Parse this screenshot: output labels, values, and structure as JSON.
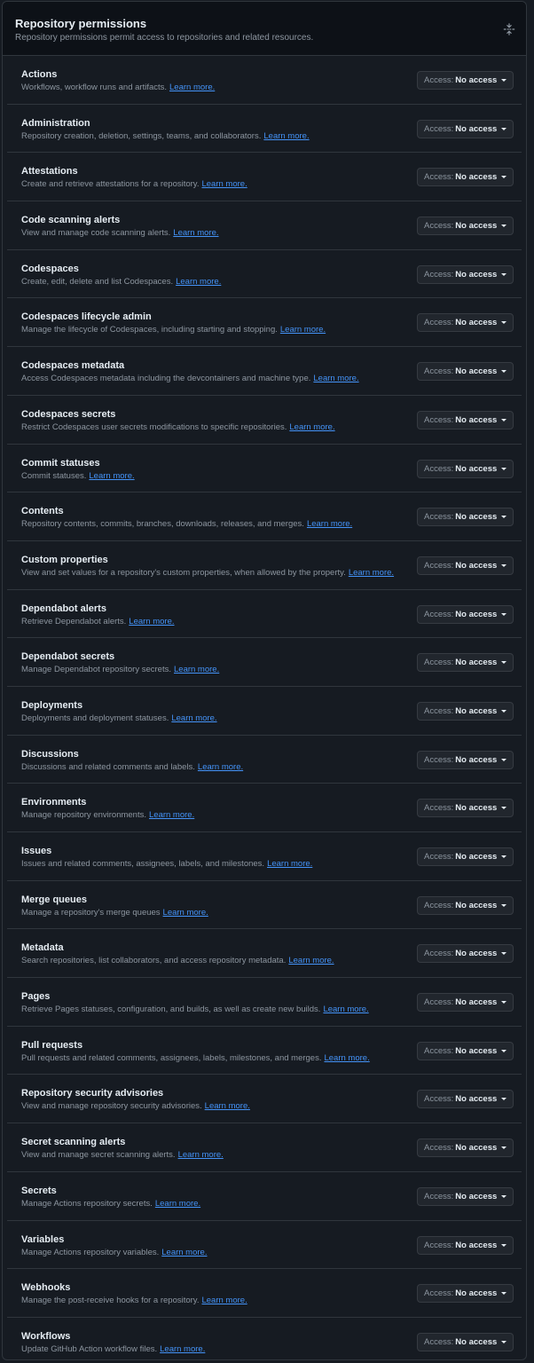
{
  "header": {
    "title": "Repository permissions",
    "subtitle": "Repository permissions permit access to repositories and related resources.",
    "fold_icon": "fold-icon"
  },
  "access_label": "Access:",
  "learn_more_label": "Learn more.",
  "permissions": [
    {
      "name": "Actions",
      "description": "Workflows, workflow runs and artifacts.",
      "access": "No access"
    },
    {
      "name": "Administration",
      "description": "Repository creation, deletion, settings, teams, and collaborators.",
      "access": "No access"
    },
    {
      "name": "Attestations",
      "description": "Create and retrieve attestations for a repository.",
      "access": "No access"
    },
    {
      "name": "Code scanning alerts",
      "description": "View and manage code scanning alerts.",
      "access": "No access"
    },
    {
      "name": "Codespaces",
      "description": "Create, edit, delete and list Codespaces.",
      "access": "No access"
    },
    {
      "name": "Codespaces lifecycle admin",
      "description": "Manage the lifecycle of Codespaces, including starting and stopping.",
      "access": "No access"
    },
    {
      "name": "Codespaces metadata",
      "description": "Access Codespaces metadata including the devcontainers and machine type.",
      "access": "No access"
    },
    {
      "name": "Codespaces secrets",
      "description": "Restrict Codespaces user secrets modifications to specific repositories.",
      "access": "No access"
    },
    {
      "name": "Commit statuses",
      "description": "Commit statuses.",
      "access": "No access"
    },
    {
      "name": "Contents",
      "description": "Repository contents, commits, branches, downloads, releases, and merges.",
      "access": "No access"
    },
    {
      "name": "Custom properties",
      "description": "View and set values for a repository's custom properties, when allowed by the property.",
      "access": "No access"
    },
    {
      "name": "Dependabot alerts",
      "description": "Retrieve Dependabot alerts.",
      "access": "No access"
    },
    {
      "name": "Dependabot secrets",
      "description": "Manage Dependabot repository secrets.",
      "access": "No access"
    },
    {
      "name": "Deployments",
      "description": "Deployments and deployment statuses.",
      "access": "No access"
    },
    {
      "name": "Discussions",
      "description": "Discussions and related comments and labels.",
      "access": "No access"
    },
    {
      "name": "Environments",
      "description": "Manage repository environments.",
      "access": "No access"
    },
    {
      "name": "Issues",
      "description": "Issues and related comments, assignees, labels, and milestones.",
      "access": "No access"
    },
    {
      "name": "Merge queues",
      "description": "Manage a repository's merge queues",
      "access": "No access"
    },
    {
      "name": "Metadata",
      "description": "Search repositories, list collaborators, and access repository metadata.",
      "access": "No access"
    },
    {
      "name": "Pages",
      "description": "Retrieve Pages statuses, configuration, and builds, as well as create new builds.",
      "access": "No access"
    },
    {
      "name": "Pull requests",
      "description": "Pull requests and related comments, assignees, labels, milestones, and merges.",
      "access": "No access"
    },
    {
      "name": "Repository security advisories",
      "description": "View and manage repository security advisories.",
      "access": "No access"
    },
    {
      "name": "Secret scanning alerts",
      "description": "View and manage secret scanning alerts.",
      "access": "No access"
    },
    {
      "name": "Secrets",
      "description": "Manage Actions repository secrets.",
      "access": "No access"
    },
    {
      "name": "Variables",
      "description": "Manage Actions repository variables.",
      "access": "No access"
    },
    {
      "name": "Webhooks",
      "description": "Manage the post-receive hooks for a repository.",
      "access": "No access"
    },
    {
      "name": "Workflows",
      "description": "Update GitHub Action workflow files.",
      "access": "No access"
    }
  ]
}
